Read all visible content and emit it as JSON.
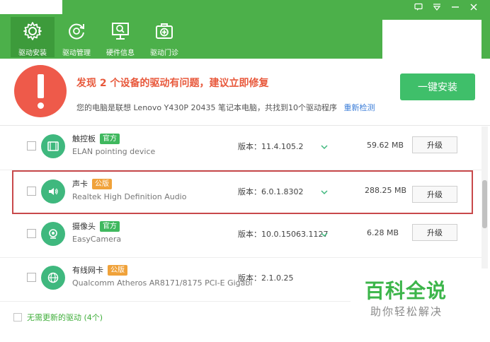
{
  "nav": {
    "tabs": [
      {
        "label": "驱动安装",
        "icon": "gear-icon",
        "active": true
      },
      {
        "label": "驱动管理",
        "icon": "refresh-icon",
        "active": false
      },
      {
        "label": "硬件信息",
        "icon": "monitor-search-icon",
        "active": false
      },
      {
        "label": "驱动门诊",
        "icon": "medical-box-icon",
        "active": false
      }
    ]
  },
  "window_controls": [
    "message-icon",
    "dropdown-icon",
    "minimize-icon",
    "close-icon"
  ],
  "alert": {
    "title": "发现 2 个设备的驱动有问题，建议立即修复",
    "description": "您的电脑是联想 Lenovo Y430P 20435 笔记本电脑，共找到10个驱动程序",
    "rescan_label": "重新检测",
    "install_label": "一键安装"
  },
  "drivers": [
    {
      "name": "触控板",
      "badge": "官方",
      "badge_type": "official",
      "model": "ELAN pointing device",
      "version": "版本：11.4.105.2",
      "size": "59.62 MB",
      "action": "升级",
      "icon": "touchpad-icon",
      "highlight": false
    },
    {
      "name": "声卡",
      "badge": "公版",
      "badge_type": "public",
      "model": "Realtek High Definition Audio",
      "version": "版本：6.0.1.8302",
      "size": "288.25 MB",
      "action": "升级",
      "icon": "speaker-icon",
      "highlight": true
    },
    {
      "name": "摄像头",
      "badge": "官方",
      "badge_type": "official",
      "model": "EasyCamera",
      "version": "版本：10.0.15063.1127",
      "size": "6.28 MB",
      "action": "升级",
      "icon": "camera-icon",
      "highlight": false
    },
    {
      "name": "有线网卡",
      "badge": "公版",
      "badge_type": "public",
      "model": "Qualcomm Atheros AR8171/8175 PCI-E Gigabi",
      "version": "版本：2.1.0.25",
      "size": "",
      "action": "",
      "icon": "globe-icon",
      "highlight": false
    }
  ],
  "footer": {
    "label": "无需更新的驱动 (4个)"
  },
  "watermark": {
    "main": "百科全说",
    "sub": "助你轻松解决"
  },
  "colors": {
    "header_green": "#4cb04a",
    "alert_red": "#ee5a4a",
    "install_green": "#3fbf6a",
    "highlight_border": "#c8494b"
  }
}
